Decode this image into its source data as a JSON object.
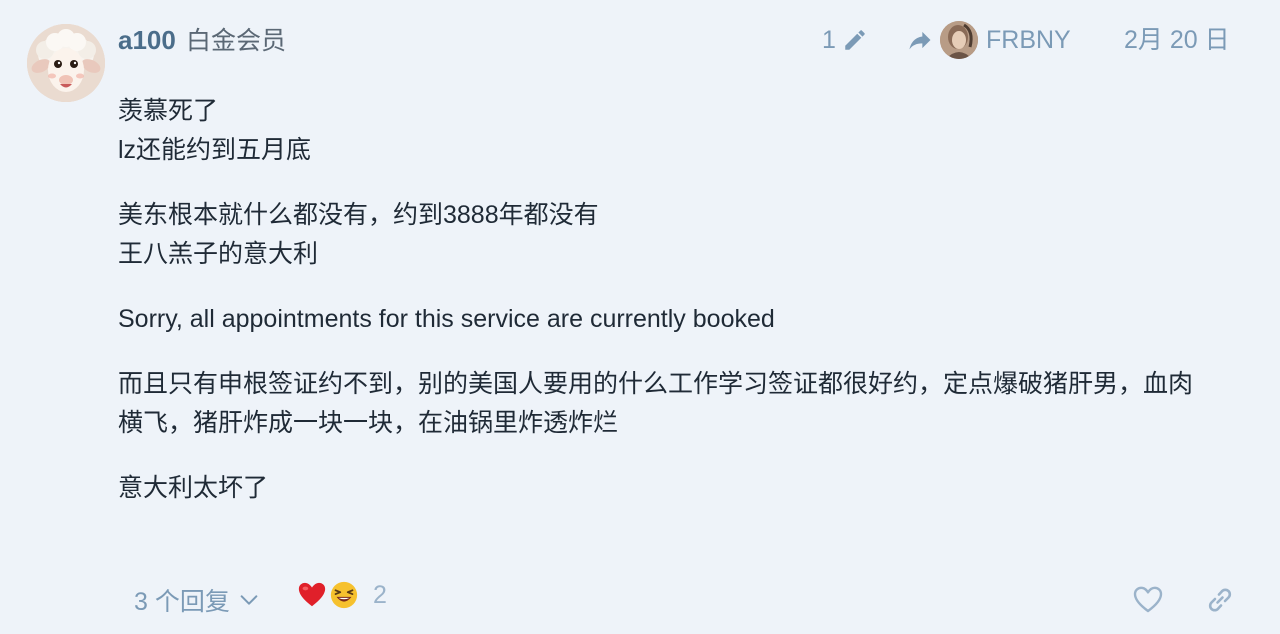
{
  "post": {
    "username": "a100",
    "user_title": "白金会员",
    "edit_count": "1",
    "reply_to_user": "FRBNY",
    "date": "2月 20 日",
    "paragraphs": [
      [
        "羡慕死了",
        "lz还能约到五月底"
      ],
      [
        "美东根本就什么都没有，约到3888年都没有",
        "王八羔子的意大利"
      ],
      [
        "Sorry, all appointments for this service are currently booked"
      ],
      [
        "而且只有申根签证约不到，别的美国人要用的什么工作学习签证都很好约，定点爆破猪肝男，血肉",
        "横飞，猪肝炸成一块一块，在油锅里炸透炸烂"
      ],
      [
        "意大利太坏了"
      ]
    ]
  },
  "footer": {
    "replies_label": "3 个回复",
    "reaction_count": "2",
    "reaction_emojis": [
      "red-heart",
      "laughing-face"
    ]
  },
  "icons": {
    "edit": "pencil-icon",
    "reply_to": "share-arrow-icon",
    "replies_toggle": "chevron-down-icon",
    "like": "heart-icon",
    "share": "link-icon"
  },
  "colors": {
    "background": "#eef3f9",
    "username": "#4b6d8a",
    "meta": "#7b9ab6",
    "text": "#1f2a36",
    "heart": "#e0202a",
    "laugh": "#f6c12e"
  }
}
